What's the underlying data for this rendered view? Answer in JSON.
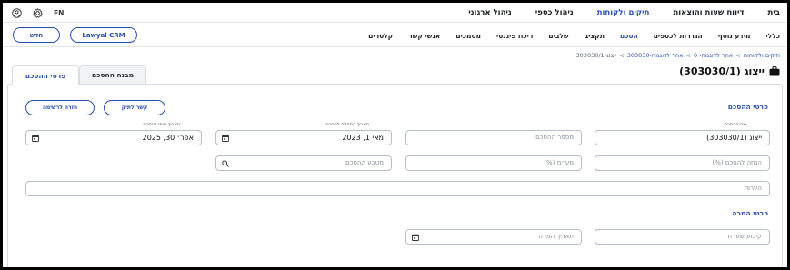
{
  "topbar": {
    "nav": [
      "בית",
      "דיווח שעות והוצאות",
      "תיקים ולקוחות",
      "ניהול כספי",
      "ניהול ארגוני"
    ],
    "active_index": 2,
    "lang": "EN",
    "icons": [
      "user-icon",
      "settings-icon"
    ]
  },
  "secondbar": {
    "nav": [
      "כללי",
      "מידע נוסף",
      "הגדרות לכספים",
      "הסכם",
      "תקציב",
      "שלבים",
      "ריכוז פיננסי",
      "מסמכים",
      "אנשי קשר",
      "קלסרים"
    ],
    "active_index": 3,
    "crm_label": "Lawyal CRM",
    "new_label": "חדש"
  },
  "breadcrumb": {
    "items": [
      "תיקים ולקוחות",
      "אחר לדוגמה- 0",
      "אחר לדוגמה-303030",
      "ייצוג-303030/1"
    ]
  },
  "page": {
    "title": "ייצוג (303030/1)",
    "title_icon": "briefcase-icon"
  },
  "tabs": {
    "details": "פרטי ההסכם",
    "structure": "מבנה ההסכם"
  },
  "agreement": {
    "section_title": "פרטי ההסכם",
    "link_case_label": "קשר לתיק",
    "back_to_list_label": "חזרה לרשימה",
    "name_label": "שם ההסכם",
    "name_value": "ייצוג (303030/1)",
    "number_placeholder": "מספר ההסכם",
    "start_date_label": "תאריך התחלה להסכם",
    "start_date_value": "מאי 1, 2023",
    "end_date_label": "תאריך סופי להסכם",
    "end_date_value": "אפר׳ 30, 2025",
    "discount_placeholder": "הנחה להסכם (%)",
    "vat_placeholder": "מע״מ (%)",
    "currency_placeholder": "מטבע ההסכם",
    "notes_placeholder": "הערות"
  },
  "conversion": {
    "section_title": "פרטי המרה",
    "rate_placeholder": "קיבוע שע״ח",
    "date_placeholder": "תאריך המרה"
  },
  "colors": {
    "accent": "#2d4fb4",
    "border": "#b8bfca"
  }
}
